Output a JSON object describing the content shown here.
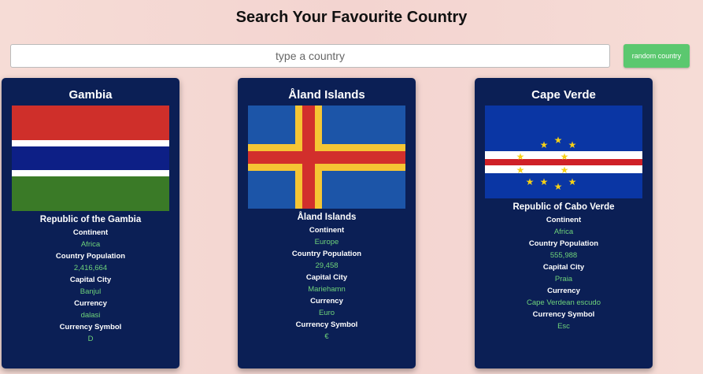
{
  "header": {
    "title": "Search Your Favourite Country"
  },
  "search": {
    "placeholder": "type a country",
    "button_label": "random country"
  },
  "labels": {
    "continent": "Continent",
    "population": "Country Population",
    "capital": "Capital City",
    "currency": "Currency",
    "currency_symbol": "Currency Symbol"
  },
  "colors": {
    "card_bg": "#0b1f55",
    "value_green": "#6fd37a",
    "button_green": "#5bc86f"
  },
  "cards": [
    {
      "name": "Gambia",
      "flag_icon": "gambia-flag",
      "official_name": "Republic of the Gambia",
      "continent": "Africa",
      "population": "2,416,664",
      "capital": "Banjul",
      "currency": "dalasi",
      "currency_symbol": "D"
    },
    {
      "name": "Åland Islands",
      "flag_icon": "aland-flag",
      "official_name": "Åland Islands",
      "continent": "Europe",
      "population": "29,458",
      "capital": "Mariehamn",
      "currency": "Euro",
      "currency_symbol": "€"
    },
    {
      "name": "Cape Verde",
      "flag_icon": "cape-verde-flag",
      "official_name": "Republic of Cabo Verde",
      "continent": "Africa",
      "population": "555,988",
      "capital": "Praia",
      "currency": "Cape Verdean escudo",
      "currency_symbol": "Esc"
    }
  ]
}
